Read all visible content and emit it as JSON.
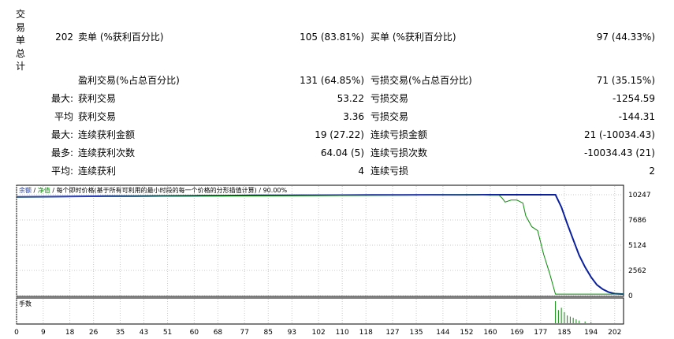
{
  "summary": {
    "title_chars": [
      "交",
      "易",
      "单",
      "总",
      "计"
    ],
    "total": "202",
    "sell_label": "卖单 (%获利百分比)",
    "sell_value": "105 (83.81%)",
    "buy_label": "买单 (%获利百分比)",
    "buy_value": "97 (44.33%)"
  },
  "stats": {
    "profit_trades_label": "盈利交易(%占总百分比)",
    "profit_trades_value": "131 (64.85%)",
    "loss_trades_label": "亏损交易(%占总百分比)",
    "loss_trades_value": "71 (35.15%)",
    "rows": [
      {
        "prefix": "最大:",
        "left_label": "获利交易",
        "left_value": "53.22",
        "right_label": "亏损交易",
        "right_value": "-1254.59"
      },
      {
        "prefix": "平均",
        "left_label": "获利交易",
        "left_value": "3.36",
        "right_label": "亏损交易",
        "right_value": "-144.31"
      },
      {
        "prefix": "最大:",
        "left_label": "连续获利金额",
        "left_value": "19 (27.22)",
        "right_label": "连续亏损金额",
        "right_value": "21 (-10034.43)"
      },
      {
        "prefix": "最多:",
        "left_label": "连续获利次数",
        "left_value": "64.04 (5)",
        "right_label": "连续亏损次数",
        "right_value": "-10034.43 (21)"
      },
      {
        "prefix": "平均:",
        "left_label": "连续获利",
        "left_value": "4",
        "right_label": "连续亏损",
        "right_value": "2"
      }
    ]
  },
  "chart_data": {
    "type": "line",
    "legend": {
      "balance": "余额",
      "sep1": " / ",
      "equity": "净值",
      "sep2": " / ",
      "model": "每个即时价格(基于所有可利用的最小时段的每一个价格的分形插值计算)",
      "sep3": " / ",
      "quality": "90.00%"
    },
    "colors": {
      "balance": "#0a1f9c",
      "equity": "#0a8a0a",
      "volume": "#0a8a0a",
      "legend_blue": "#1a3aa8",
      "legend_green": "#118811"
    },
    "x_ticks": [
      0,
      9,
      18,
      26,
      35,
      43,
      51,
      60,
      68,
      77,
      85,
      93,
      102,
      110,
      118,
      127,
      135,
      144,
      152,
      160,
      169,
      177,
      185,
      194,
      202
    ],
    "y_ticks": [
      0,
      2562,
      5124,
      7686,
      10247
    ],
    "ylim": [
      0,
      10247
    ],
    "xlim": [
      0,
      205
    ],
    "series": [
      {
        "name": "余额",
        "x": [
          0,
          10,
          20,
          30,
          40,
          50,
          60,
          70,
          80,
          90,
          100,
          110,
          120,
          130,
          140,
          150,
          160,
          170,
          175,
          182,
          184,
          186,
          188,
          190,
          192,
          194,
          196,
          198,
          200,
          202,
          205
        ],
        "values": [
          10020,
          10050,
          10080,
          10100,
          10110,
          10130,
          10150,
          10160,
          10180,
          10190,
          10200,
          10210,
          10220,
          10230,
          10235,
          10240,
          10245,
          10247,
          10247,
          10245,
          9000,
          7300,
          5700,
          4100,
          2900,
          1900,
          1100,
          650,
          350,
          200,
          150
        ]
      },
      {
        "name": "净值",
        "x": [
          0,
          150,
          155,
          160,
          163,
          164,
          165,
          167,
          169,
          171,
          172,
          174,
          176,
          178,
          180,
          182,
          205
        ],
        "values": [
          10020,
          10220,
          10220,
          10180,
          10180,
          9900,
          9500,
          9700,
          9700,
          9400,
          8100,
          7000,
          6600,
          4200,
          2300,
          150,
          150
        ]
      }
    ],
    "volume_label": "手数",
    "volume": {
      "x": [
        182,
        183,
        184,
        185,
        186,
        187,
        188,
        189,
        190,
        192,
        194
      ],
      "values": [
        1.0,
        0.6,
        0.7,
        0.5,
        0.35,
        0.3,
        0.25,
        0.18,
        0.12,
        0.08,
        0.05
      ]
    }
  }
}
